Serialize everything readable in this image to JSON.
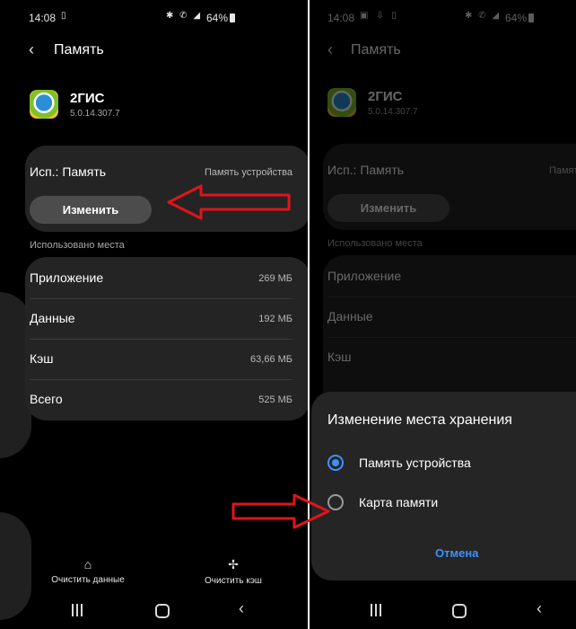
{
  "status": {
    "time": "14:08",
    "left_icons": [
      "sim-icon"
    ],
    "left_icons_right": [
      "gallery-icon",
      "download-icon",
      "sim-icon"
    ],
    "right_icons": [
      "bluetooth-icon",
      "vibrate-icon",
      "signal-icon"
    ],
    "battery": "64%"
  },
  "appbar": {
    "title": "Память"
  },
  "app": {
    "name": "2ГИС",
    "version": "5.0.14.307.7"
  },
  "storage": {
    "label": "Исп.: Память",
    "value": "Память устройства",
    "button": "Изменить"
  },
  "usage": {
    "header": "Использовано места",
    "rows": [
      {
        "label": "Приложение",
        "value": "269 МБ"
      },
      {
        "label": "Данные",
        "value": "192 МБ"
      },
      {
        "label": "Кэш",
        "value": "63,66 МБ"
      },
      {
        "label": "Всего",
        "value": "525 МБ"
      }
    ]
  },
  "actions": {
    "clear_data": "Очистить данные",
    "clear_cache": "Очистить кэш"
  },
  "dialog": {
    "title": "Изменение места хранения",
    "options": [
      {
        "label": "Память устройства",
        "selected": true
      },
      {
        "label": "Карта памяти",
        "selected": false
      }
    ],
    "cancel": "Отмена"
  },
  "colors": {
    "accent": "#3e91ff",
    "arrow": "#e0141b",
    "card": "#242424"
  }
}
